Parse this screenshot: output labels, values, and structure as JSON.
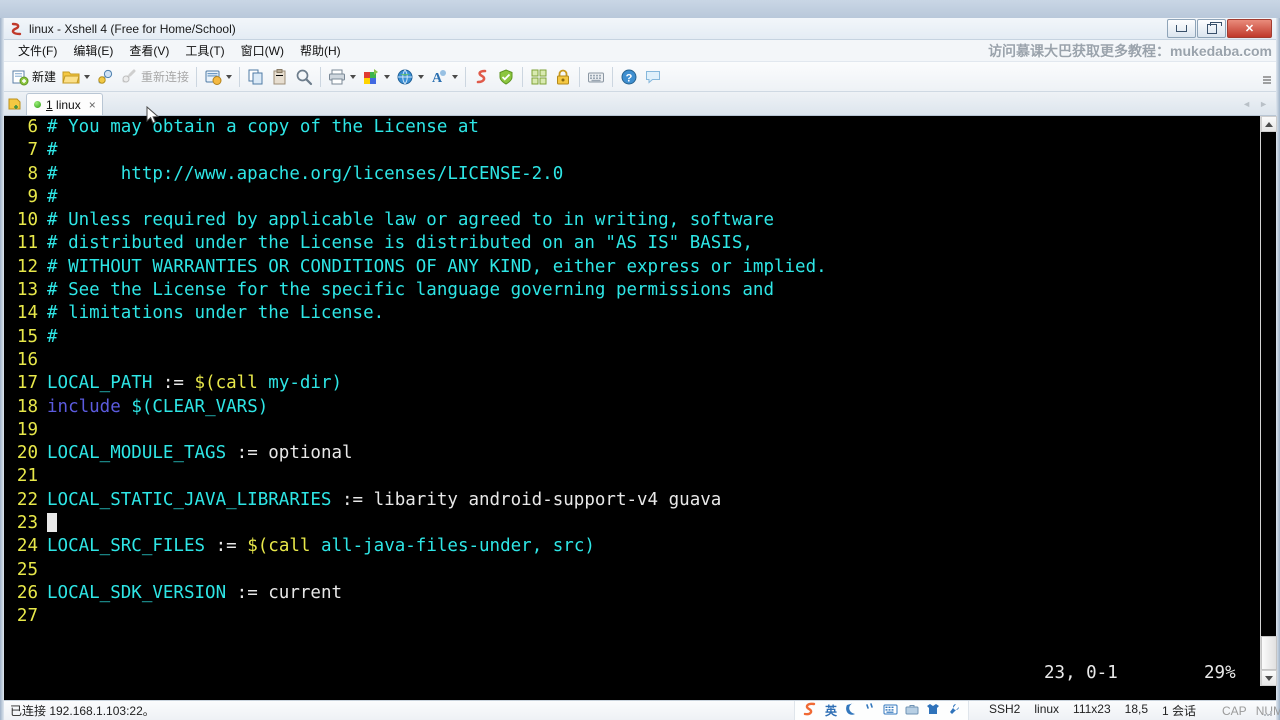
{
  "window": {
    "title": "linux - Xshell 4 (Free for Home/School)",
    "app_icon": "xshell-icon",
    "buttons": {
      "minimize": "minimize",
      "restore": "restore",
      "close": "close"
    }
  },
  "menubar": {
    "items": [
      {
        "label": "文件(F)",
        "name": "menu-file"
      },
      {
        "label": "编辑(E)",
        "name": "menu-edit"
      },
      {
        "label": "查看(V)",
        "name": "menu-view"
      },
      {
        "label": "工具(T)",
        "name": "menu-tools"
      },
      {
        "label": "窗口(W)",
        "name": "menu-window"
      },
      {
        "label": "帮助(H)",
        "name": "menu-help"
      }
    ]
  },
  "watermark": {
    "text": "访问慕课大巴获取更多教程：mukedaba.com"
  },
  "toolbar": {
    "new_label": "新建",
    "reconnect_label": "重新连接",
    "overflow": "»"
  },
  "tabbar": {
    "tabs": [
      {
        "index": "1",
        "label": "linux",
        "close": "×",
        "status": "connected"
      }
    ],
    "left_icon": "new-tab-icon",
    "scroll_left": "◄",
    "scroll_right": "►"
  },
  "terminal": {
    "colors": {
      "background": "#000000",
      "line_number": "#e8e84a",
      "comment": "#2ee6e6",
      "text": "#e8e8e8",
      "variable": "#2ee6e6",
      "function": "#e8e84a",
      "keyword": "#5b5bde",
      "cursor": "#e9e9e9"
    },
    "lines": [
      {
        "num": "6",
        "tokens": [
          {
            "t": "# You may obtain a copy of the License at",
            "c": "c-cyan"
          }
        ]
      },
      {
        "num": "7",
        "tokens": [
          {
            "t": "#",
            "c": "c-cyan"
          }
        ]
      },
      {
        "num": "8",
        "tokens": [
          {
            "t": "#      http://www.apache.org/licenses/LICENSE-2.0",
            "c": "c-cyan"
          }
        ]
      },
      {
        "num": "9",
        "tokens": [
          {
            "t": "#",
            "c": "c-cyan"
          }
        ]
      },
      {
        "num": "10",
        "tokens": [
          {
            "t": "# Unless required by applicable law or agreed to in writing, software",
            "c": "c-cyan"
          }
        ]
      },
      {
        "num": "11",
        "tokens": [
          {
            "t": "# distributed under the License is distributed on an \"AS IS\" BASIS,",
            "c": "c-cyan"
          }
        ]
      },
      {
        "num": "12",
        "tokens": [
          {
            "t": "# WITHOUT WARRANTIES OR CONDITIONS OF ANY KIND, either express or implied.",
            "c": "c-cyan"
          }
        ]
      },
      {
        "num": "13",
        "tokens": [
          {
            "t": "# See the License for the specific language governing permissions and",
            "c": "c-cyan"
          }
        ]
      },
      {
        "num": "14",
        "tokens": [
          {
            "t": "# limitations under the License.",
            "c": "c-cyan"
          }
        ]
      },
      {
        "num": "15",
        "tokens": [
          {
            "t": "#",
            "c": "c-cyan"
          }
        ]
      },
      {
        "num": "16",
        "tokens": []
      },
      {
        "num": "17",
        "tokens": [
          {
            "t": "LOCAL_PATH",
            "c": "c-cyan"
          },
          {
            "t": " := ",
            "c": "c-white"
          },
          {
            "t": "$(",
            "c": "c-yellow"
          },
          {
            "t": "call",
            "c": "c-yellow"
          },
          {
            "t": " my-dir)",
            "c": "c-cyan"
          }
        ]
      },
      {
        "num": "18",
        "tokens": [
          {
            "t": "include",
            "c": "c-blue"
          },
          {
            "t": " ",
            "c": "c-white"
          },
          {
            "t": "$(CLEAR_VARS)",
            "c": "c-cyan"
          }
        ]
      },
      {
        "num": "19",
        "tokens": []
      },
      {
        "num": "20",
        "tokens": [
          {
            "t": "LOCAL_MODULE_TAGS",
            "c": "c-cyan"
          },
          {
            "t": " := optional",
            "c": "c-white"
          }
        ]
      },
      {
        "num": "21",
        "tokens": []
      },
      {
        "num": "22",
        "tokens": [
          {
            "t": "LOCAL_STATIC_JAVA_LIBRARIES",
            "c": "c-cyan"
          },
          {
            "t": " := libarity android-support-v4 guava",
            "c": "c-white"
          }
        ]
      },
      {
        "num": "23",
        "tokens": [
          {
            "t": "",
            "c": "c-white",
            "cursor": true
          }
        ]
      },
      {
        "num": "24",
        "tokens": [
          {
            "t": "LOCAL_SRC_FILES",
            "c": "c-cyan"
          },
          {
            "t": " := ",
            "c": "c-white"
          },
          {
            "t": "$(",
            "c": "c-yellow"
          },
          {
            "t": "call",
            "c": "c-yellow"
          },
          {
            "t": " all-java-files-under, src)",
            "c": "c-cyan"
          }
        ]
      },
      {
        "num": "25",
        "tokens": []
      },
      {
        "num": "26",
        "tokens": [
          {
            "t": "LOCAL_SDK_VERSION",
            "c": "c-cyan"
          },
          {
            "t": " := current",
            "c": "c-white"
          }
        ]
      },
      {
        "num": "27",
        "tokens": []
      }
    ],
    "status": {
      "position": "23, 0-1",
      "percent": "29%"
    }
  },
  "scrollbar": {
    "up": "scroll-up",
    "down": "scroll-down",
    "thumb": "scroll-thumb"
  },
  "statusbar": {
    "connection": "已连接 192.168.1.103:22。",
    "ime": [
      "英"
    ],
    "protocol": "SSH2",
    "session_name": "linux",
    "size": "111x23",
    "cursor_pos": "18,5",
    "sessions": "1 会话",
    "caps": "CAP",
    "num": "NUM"
  }
}
